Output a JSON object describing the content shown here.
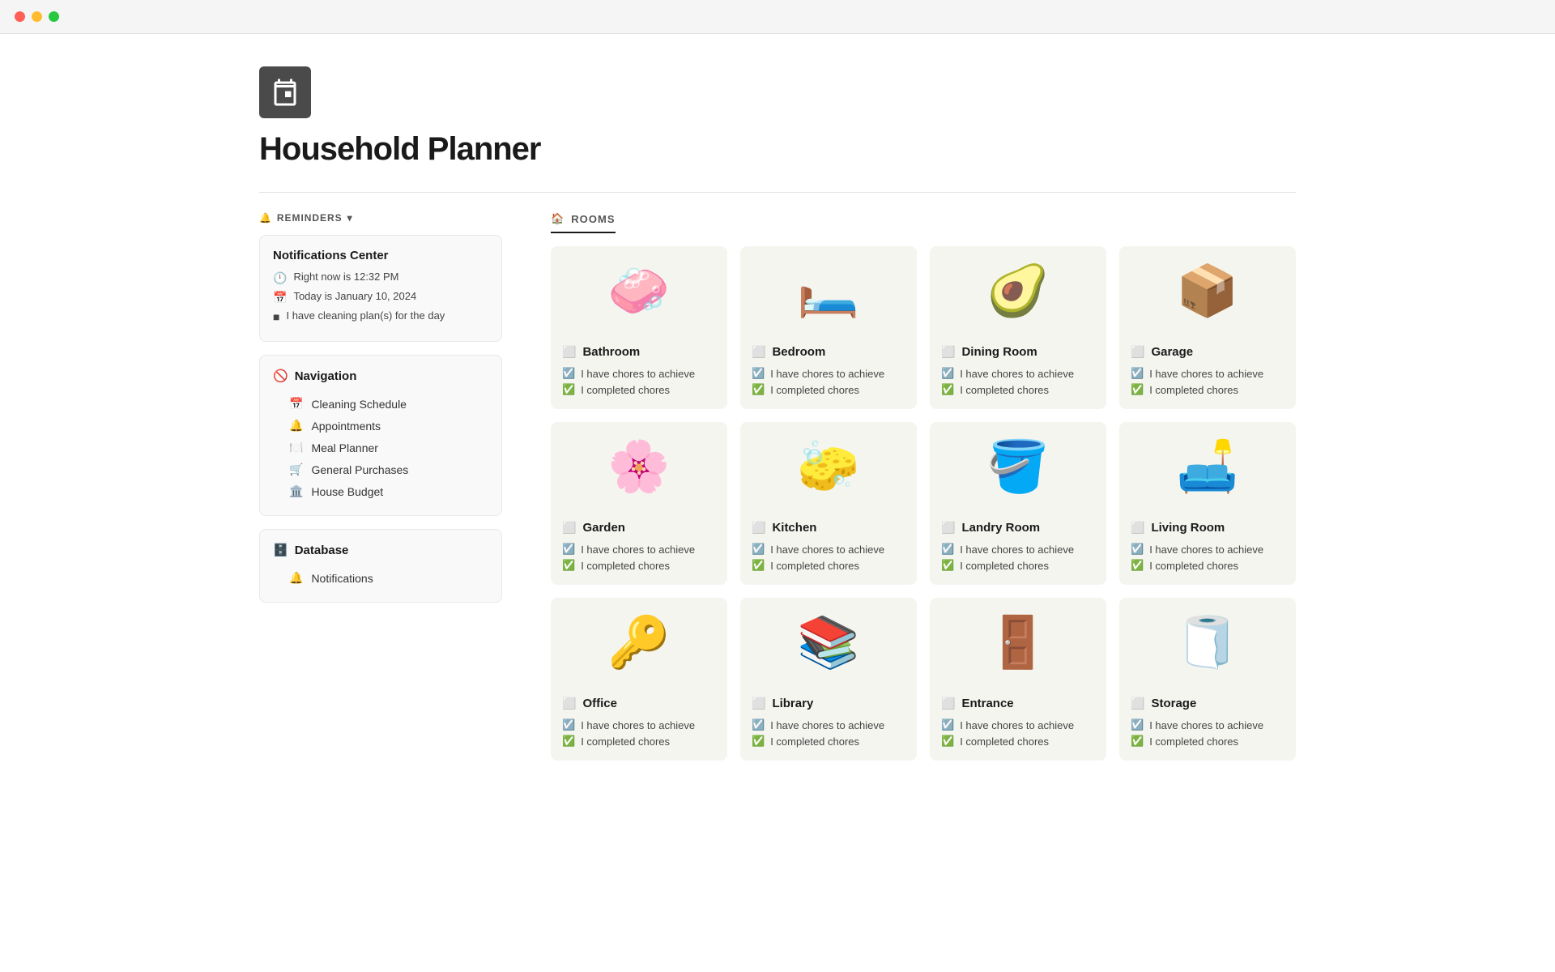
{
  "titlebar": {
    "lights": [
      "red",
      "yellow",
      "green"
    ]
  },
  "page": {
    "icon_alt": "calendar icon",
    "title": "Household Planner"
  },
  "sidebar": {
    "reminders_label": "REMINDERS",
    "chevron": "▾",
    "notifications_center": {
      "title": "Notifications Center",
      "items": [
        {
          "icon": "🕛",
          "text": "Right now is 12:32 PM"
        },
        {
          "icon": "📅",
          "text": "Today is January 10, 2024"
        },
        {
          "icon": "■",
          "text": "I have cleaning plan(s) for the day"
        }
      ]
    },
    "navigation": {
      "title": "Navigation",
      "title_icon": "🚫",
      "items": [
        {
          "icon": "📅",
          "label": "Cleaning Schedule"
        },
        {
          "icon": "🔔",
          "label": "Appointments"
        },
        {
          "icon": "🍽️",
          "label": "Meal Planner"
        },
        {
          "icon": "🛒",
          "label": "General Purchases"
        },
        {
          "icon": "🏛️",
          "label": "House Budget"
        }
      ]
    },
    "database": {
      "title": "Database",
      "title_icon": "🗄️",
      "items": [
        {
          "icon": "🔔",
          "label": "Notifications"
        }
      ]
    }
  },
  "main": {
    "rooms_label": "ROOMS",
    "rooms_icon": "🏠",
    "rooms": [
      {
        "name": "Bathroom",
        "emoji": "🧼",
        "chore1": "I have chores to achieve",
        "chore2": "I completed chores"
      },
      {
        "name": "Bedroom",
        "emoji": "🛏️",
        "chore1": "I have chores to achieve",
        "chore2": "I completed chores"
      },
      {
        "name": "Dining Room",
        "emoji": "🥑",
        "chore1": "I have chores to achieve",
        "chore2": "I completed chores"
      },
      {
        "name": "Garage",
        "emoji": "📦",
        "chore1": "I have chores to achieve",
        "chore2": "I completed chores"
      },
      {
        "name": "Garden",
        "emoji": "🌸",
        "chore1": "I have chores to achieve",
        "chore2": "I completed chores"
      },
      {
        "name": "Kitchen",
        "emoji": "🧽",
        "chore1": "I have chores to achieve",
        "chore2": "I completed chores"
      },
      {
        "name": "Landry Room",
        "emoji": "🪣",
        "chore1": "I have chores to achieve",
        "chore2": "I completed chores"
      },
      {
        "name": "Living Room",
        "emoji": "🛋️",
        "chore1": "I have chores to achieve",
        "chore2": "I completed chores"
      },
      {
        "name": "Office",
        "emoji": "🔑",
        "chore1": "I have chores to achieve",
        "chore2": "I completed chores"
      },
      {
        "name": "Library",
        "emoji": "📚",
        "chore1": "I have chores to achieve",
        "chore2": "I completed chores"
      },
      {
        "name": "Entrance",
        "emoji": "🚪",
        "chore1": "I have chores to achieve",
        "chore2": "I completed chores"
      },
      {
        "name": "Storage",
        "emoji": "🧻",
        "chore1": "I have chores to achieve",
        "chore2": "I completed chores"
      }
    ]
  }
}
